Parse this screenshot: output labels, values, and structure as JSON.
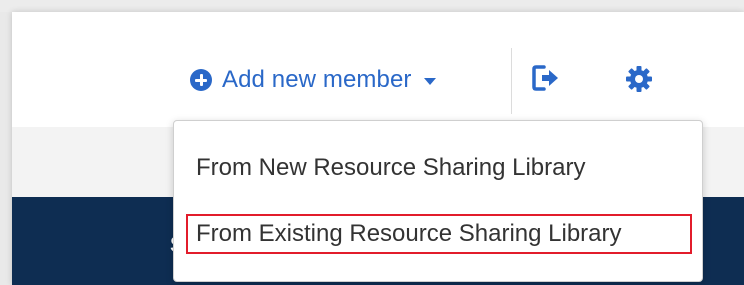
{
  "toolbar": {
    "add_member_label": "Add new member",
    "icons": [
      "plus-circle-icon",
      "caret-down-icon",
      "logout-icon",
      "gear-icon"
    ],
    "accent_color": "#2a68c8"
  },
  "dropdown": {
    "items": [
      {
        "label": "From New Resource Sharing Library",
        "highlighted": false
      },
      {
        "label": "From Existing Resource Sharing Library",
        "highlighted": true
      }
    ],
    "highlight_color": "#e21c2b"
  },
  "background": {
    "navy_band_color": "#0e2d52",
    "navy_band_text": "S"
  }
}
